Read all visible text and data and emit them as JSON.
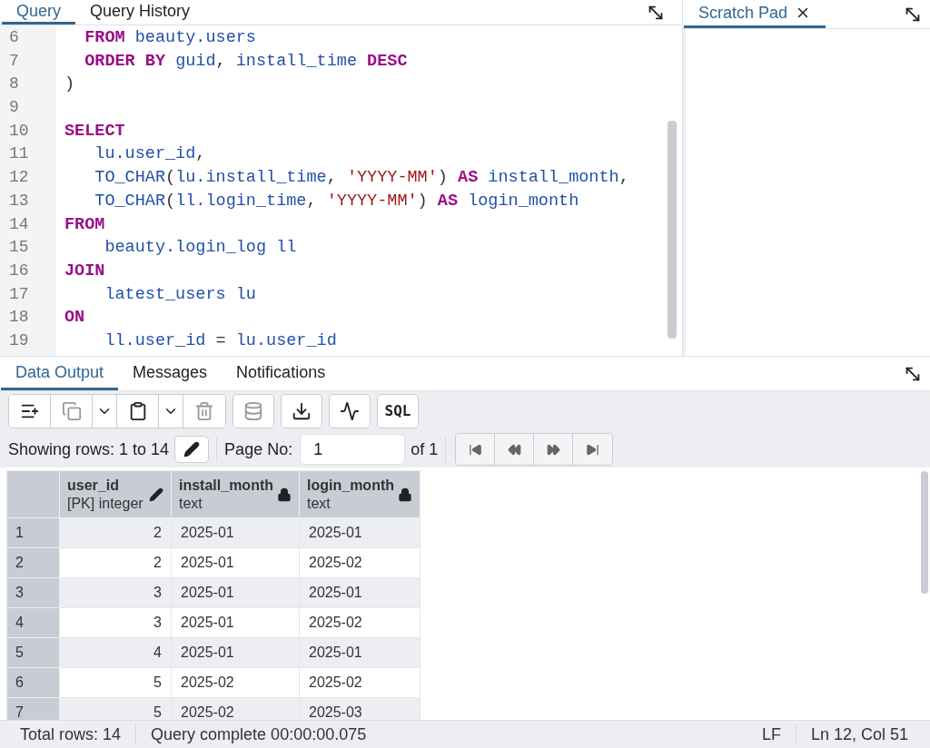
{
  "query_panel": {
    "tabs": [
      {
        "label": "Query",
        "selected": true
      },
      {
        "label": "Query History",
        "selected": false
      }
    ],
    "editor_lines": [
      {
        "number": "6",
        "tokens": [
          {
            "kind": "keyword",
            "text": "  FROM"
          },
          {
            "kind": "ident",
            "text": " beauty.users"
          }
        ]
      },
      {
        "number": "7",
        "tokens": [
          {
            "kind": "keyword",
            "text": "  ORDER BY"
          },
          {
            "kind": "ident",
            "text": " guid"
          },
          {
            "kind": "plain",
            "text": ", "
          },
          {
            "kind": "ident",
            "text": "install_time "
          },
          {
            "kind": "keyword",
            "text": "DESC"
          }
        ]
      },
      {
        "number": "8",
        "tokens": [
          {
            "kind": "plain",
            "text": ")"
          }
        ]
      },
      {
        "number": "9"
      },
      {
        "number": "10",
        "tokens": [
          {
            "kind": "keyword",
            "text": "SELECT"
          }
        ]
      },
      {
        "number": "11",
        "tokens": [
          {
            "kind": "ident",
            "text": "   lu.user_id"
          },
          {
            "kind": "plain",
            "text": ","
          }
        ]
      },
      {
        "number": "12",
        "tokens": [
          {
            "kind": "ident",
            "text": "   TO_CHAR"
          },
          {
            "kind": "plain",
            "text": "("
          },
          {
            "kind": "ident",
            "text": "lu.install_time"
          },
          {
            "kind": "plain",
            "text": ", "
          },
          {
            "kind": "string",
            "text": "'YYYY-MM'"
          },
          {
            "kind": "plain",
            "text": ") "
          },
          {
            "kind": "keyword",
            "text": "AS"
          },
          {
            "kind": "ident",
            "text": " install_month"
          },
          {
            "kind": "plain",
            "text": ","
          }
        ]
      },
      {
        "number": "13",
        "tokens": [
          {
            "kind": "ident",
            "text": "   TO_CHAR"
          },
          {
            "kind": "plain",
            "text": "("
          },
          {
            "kind": "ident",
            "text": "ll.login_time"
          },
          {
            "kind": "plain",
            "text": ", "
          },
          {
            "kind": "string",
            "text": "'YYYY-MM'"
          },
          {
            "kind": "plain",
            "text": ") "
          },
          {
            "kind": "keyword",
            "text": "AS"
          },
          {
            "kind": "ident",
            "text": " login_month"
          }
        ]
      },
      {
        "number": "14",
        "tokens": [
          {
            "kind": "keyword",
            "text": "FROM"
          }
        ]
      },
      {
        "number": "15",
        "tokens": [
          {
            "kind": "ident",
            "text": "    beauty.login_log ll"
          }
        ]
      },
      {
        "number": "16",
        "tokens": [
          {
            "kind": "keyword",
            "text": "JOIN"
          }
        ]
      },
      {
        "number": "17",
        "tokens": [
          {
            "kind": "ident",
            "text": "    latest_users lu"
          }
        ]
      },
      {
        "number": "18",
        "tokens": [
          {
            "kind": "keyword",
            "text": "ON"
          }
        ]
      },
      {
        "number": "19",
        "tokens": [
          {
            "kind": "ident",
            "text": "    ll.user_id "
          },
          {
            "kind": "plain",
            "text": "= "
          },
          {
            "kind": "ident",
            "text": "lu.user_id"
          }
        ]
      }
    ]
  },
  "scratch_pad": {
    "tab": {
      "label": "Scratch Pad",
      "selected": true
    }
  },
  "output_panel": {
    "tabs": [
      {
        "label": "Data Output",
        "selected": true
      },
      {
        "label": "Messages",
        "selected": false
      },
      {
        "label": "Notifications",
        "selected": false
      }
    ],
    "toolbar": [
      {
        "kind": "add-row",
        "disabled": false
      },
      {
        "kind": "copy",
        "disabled": true
      },
      {
        "kind": "dropdown",
        "disabled": false
      },
      {
        "kind": "paste",
        "disabled": false
      },
      {
        "kind": "dropdown",
        "disabled": false
      },
      {
        "kind": "delete",
        "disabled": true
      },
      {
        "kind": "save",
        "disabled": true
      },
      {
        "kind": "download",
        "disabled": false
      },
      {
        "kind": "graph",
        "disabled": false
      },
      {
        "kind": "sql",
        "disabled": false,
        "label": "SQL"
      }
    ],
    "pager": {
      "showing": "Showing rows: 1 to 14",
      "page_label": "Page No:",
      "page_value": "1",
      "of": "of 1",
      "buttons": [
        {
          "kind": "first",
          "disabled": true
        },
        {
          "kind": "prev",
          "disabled": true
        },
        {
          "kind": "next",
          "disabled": true
        },
        {
          "kind": "last",
          "disabled": true
        }
      ]
    },
    "table": {
      "columns": [
        {
          "name": "user_id",
          "type": "[PK] integer",
          "kind": "editable"
        },
        {
          "name": "install_month",
          "type": "text",
          "kind": "locked"
        },
        {
          "name": "login_month",
          "type": "text",
          "kind": "locked"
        }
      ],
      "rows": [
        {
          "number": "1",
          "cells": [
            "2",
            "2025-01",
            "2025-01"
          ]
        },
        {
          "number": "2",
          "cells": [
            "2",
            "2025-01",
            "2025-02"
          ]
        },
        {
          "number": "3",
          "cells": [
            "3",
            "2025-01",
            "2025-01"
          ]
        },
        {
          "number": "4",
          "cells": [
            "3",
            "2025-01",
            "2025-02"
          ]
        },
        {
          "number": "5",
          "cells": [
            "4",
            "2025-01",
            "2025-01"
          ]
        },
        {
          "number": "6",
          "cells": [
            "5",
            "2025-02",
            "2025-02"
          ]
        },
        {
          "number": "7",
          "cells": [
            "5",
            "2025-02",
            "2025-03"
          ]
        }
      ]
    }
  },
  "status_bar": {
    "total": "Total rows: 14",
    "query": "Query complete 00:00:00.075",
    "line_ending": "LF",
    "position": "Ln 12, Col 51"
  }
}
